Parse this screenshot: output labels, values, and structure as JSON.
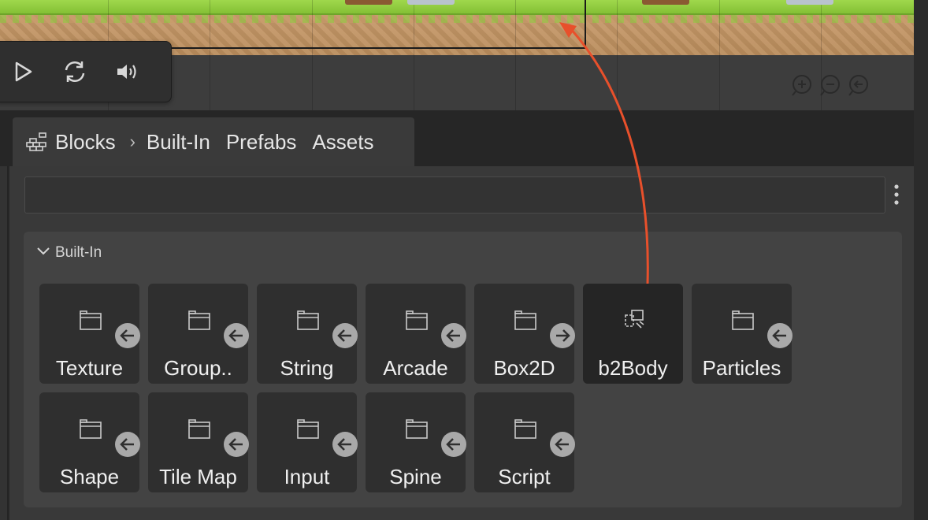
{
  "breadcrumb": {
    "root": "Blocks",
    "items": [
      "Built-In",
      "Prefabs",
      "Assets"
    ]
  },
  "search": {
    "value": "",
    "placeholder": ""
  },
  "section": {
    "title": "Built-In"
  },
  "blocks": [
    {
      "label": "Texture",
      "badge": "arrow-left"
    },
    {
      "label": "Group..",
      "badge": "arrow-left"
    },
    {
      "label": "String",
      "badge": "arrow-left"
    },
    {
      "label": "Arcade",
      "badge": "arrow-left"
    },
    {
      "label": "Box2D",
      "badge": "arrow-right"
    },
    {
      "label": "b2Body",
      "badge": "none",
      "selected": true
    },
    {
      "label": "Particles",
      "badge": "arrow-left"
    },
    {
      "label": "Shape",
      "badge": "arrow-left"
    },
    {
      "label": "Tile Map",
      "badge": "arrow-left"
    },
    {
      "label": "Input",
      "badge": "arrow-left"
    },
    {
      "label": "Spine",
      "badge": "arrow-left"
    },
    {
      "label": "Script",
      "badge": "arrow-left"
    }
  ],
  "colors": {
    "annotation_arrow": "#e8502b",
    "panel_bg": "#393939",
    "block_bg": "#2f2f2f",
    "grass": "#8fcb3f",
    "dirt": "#c79a6a"
  }
}
